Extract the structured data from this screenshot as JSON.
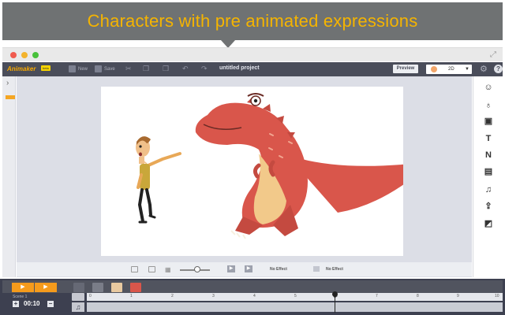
{
  "banner": {
    "caption": "Characters with pre animated expressions"
  },
  "toolbar": {
    "logo": "Animaker",
    "beta": "beta",
    "new_label": "New",
    "save_label": "Save",
    "project_title": "untitled project",
    "preview_label": "Preview",
    "mode_value": "2D"
  },
  "canvas_controls": {
    "effect_left": "No Effect",
    "effect_right": "No Effect"
  },
  "timeline": {
    "scene_label": "Scene 1",
    "duration": "00:10",
    "ticks": [
      "0",
      "1",
      "2",
      "3",
      "4",
      "5",
      "6",
      "7",
      "8",
      "9",
      "10"
    ]
  },
  "colors": {
    "accent": "#f59b1c",
    "toolbar_bg": "#4a4d5a",
    "banner_bg": "#6f7273",
    "banner_text": "#f5b400",
    "dinosaur": "#d9564b"
  },
  "icons": {
    "right_bar": [
      "character-icon",
      "prop-icon",
      "image-icon",
      "text-icon",
      "number-icon",
      "video-icon",
      "music-note-icon",
      "upload-icon",
      "background-icon"
    ]
  }
}
